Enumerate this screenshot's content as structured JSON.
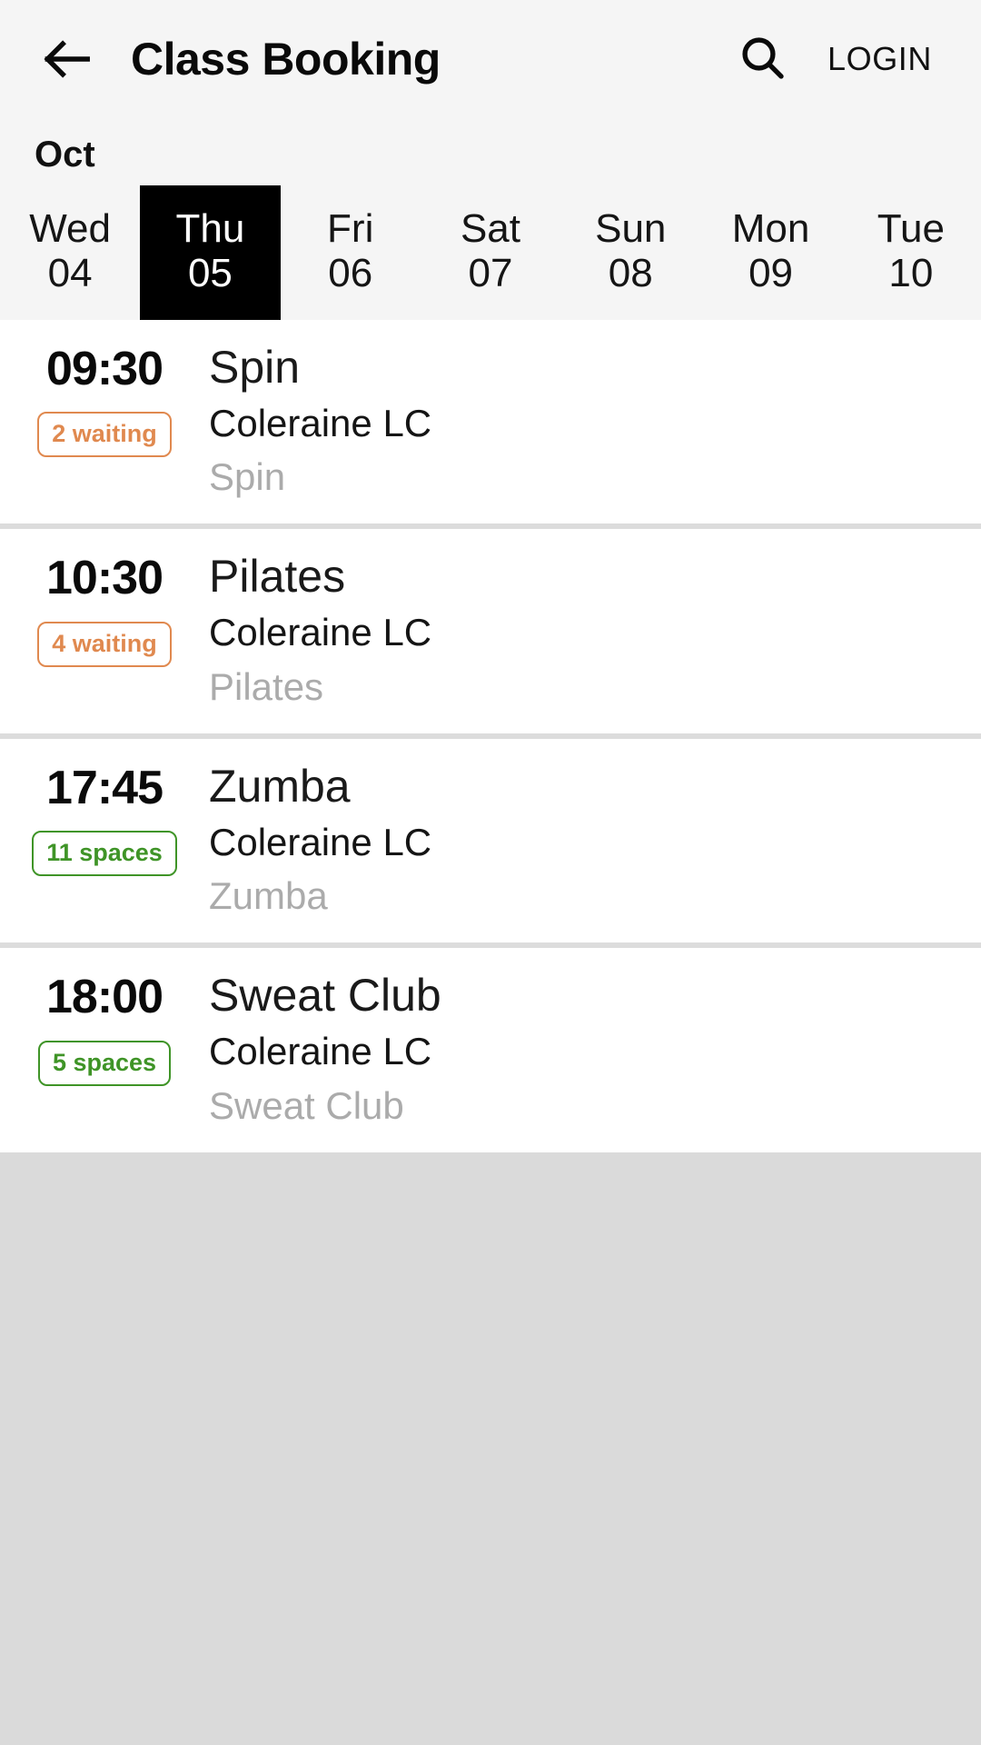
{
  "appbar": {
    "back_icon": "arrow-left-icon",
    "title": "Class Booking",
    "search_icon": "search-icon",
    "login_label": "LOGIN"
  },
  "calendar": {
    "month": "Oct",
    "days": [
      {
        "name": "Wed",
        "num": "04",
        "selected": false
      },
      {
        "name": "Thu",
        "num": "05",
        "selected": true
      },
      {
        "name": "Fri",
        "num": "06",
        "selected": false
      },
      {
        "name": "Sat",
        "num": "07",
        "selected": false
      },
      {
        "name": "Sun",
        "num": "08",
        "selected": false
      },
      {
        "name": "Mon",
        "num": "09",
        "selected": false
      },
      {
        "name": "Tue",
        "num": "10",
        "selected": false
      }
    ]
  },
  "classes": [
    {
      "time": "09:30",
      "badge": "2 waiting",
      "badge_type": "waiting",
      "name": "Spin",
      "venue": "Coleraine LC",
      "sub": "Spin"
    },
    {
      "time": "10:30",
      "badge": "4 waiting",
      "badge_type": "waiting",
      "name": "Pilates",
      "venue": "Coleraine LC",
      "sub": "Pilates"
    },
    {
      "time": "17:45",
      "badge": "11 spaces",
      "badge_type": "spaces",
      "name": "Zumba",
      "venue": "Coleraine LC",
      "sub": "Zumba"
    },
    {
      "time": "18:00",
      "badge": "5 spaces",
      "badge_type": "spaces",
      "name": "Sweat Club",
      "venue": "Coleraine LC",
      "sub": "Sweat Club"
    }
  ],
  "colors": {
    "appbar_bg": "#f5f5f5",
    "selected_day_bg": "#000000",
    "waiting_badge": "#e0894f",
    "spaces_badge": "#3f9427",
    "sub_text": "#ababab",
    "page_bg": "#dadada",
    "separator": "#dcdcdc"
  }
}
